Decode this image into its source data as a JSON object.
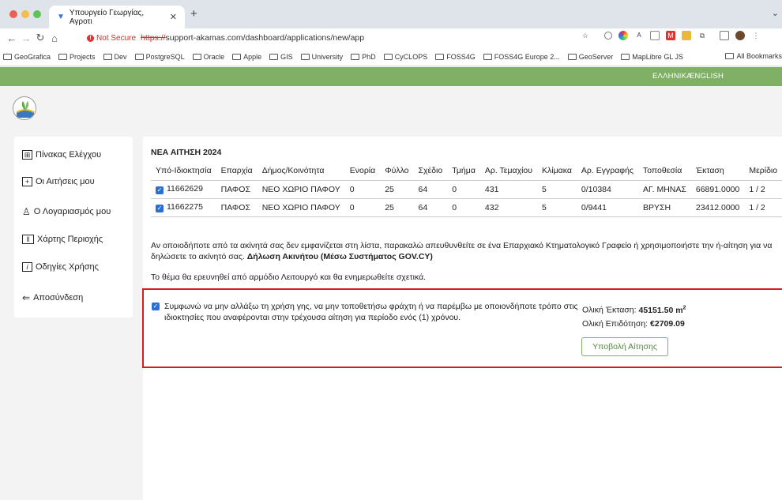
{
  "browser": {
    "tab_title": "Υπουργείο Γεωργίας, Αγροτι",
    "not_secure": "Not Secure",
    "url_scheme": "https://",
    "url_rest": "support-akamas.com/dashboard/applications/new/app",
    "bookmarks": [
      "GeoGrafica",
      "Projects",
      "Dev",
      "PostgreSQL",
      "Oracle",
      "Apple",
      "GIS",
      "University",
      "PhD",
      "CyCLOPS",
      "FOSS4G",
      "FOSS4G Europe 2...",
      "GeoServer",
      "MapLibre GL JS"
    ],
    "all_bookmarks": "All Bookmarks"
  },
  "header": {
    "lang_el": "ΕΛΛΗΝΙΚΑ",
    "lang_en": "ENGLISH",
    "accent_color": "#7fb065"
  },
  "sidebar": {
    "items": [
      {
        "label": "Πίνακας Ελέγχου",
        "icon": "dashboard-icon"
      },
      {
        "label": "Οι Αιτήσεις μου",
        "icon": "plus-square-icon"
      },
      {
        "label": "Ο Λογαριασμός μου",
        "icon": "user-icon"
      },
      {
        "label": "Χάρτης Περιοχής",
        "icon": "map-icon"
      },
      {
        "label": "Οδηγίες Χρήσης",
        "icon": "info-icon"
      },
      {
        "label": "Αποσύνδεση",
        "icon": "logout-icon"
      }
    ]
  },
  "main": {
    "section_title": "ΝΕΑ ΑΙΤΗΣΗ 2024",
    "columns": [
      "Υπό-Ιδιοκτησία",
      "Επαρχία",
      "Δήμος/Κοινότητα",
      "Ενορία",
      "Φύλλο",
      "Σχέδιο",
      "Τμήμα",
      "Αρ. Τεμαχίου",
      "Κλίμακα",
      "Αρ. Εγγραφής",
      "Τοποθεσία",
      "Έκταση",
      "Μερίδιο"
    ],
    "rows": [
      [
        "11662629",
        "ΠΑΦΟΣ",
        "ΝΕΟ ΧΩΡΙΟ ΠΑΦΟΥ",
        "0",
        "25",
        "64",
        "0",
        "431",
        "5",
        "0/10384",
        "ΑΓ. ΜΗΝΑΣ",
        "66891.0000",
        "1 / 2"
      ],
      [
        "11662275",
        "ΠΑΦΟΣ",
        "ΝΕΟ ΧΩΡΙΟ ΠΑΦΟΥ",
        "0",
        "25",
        "64",
        "0",
        "432",
        "5",
        "0/9441",
        "ΒΡΥΣΗ",
        "23412.0000",
        "1 / 2"
      ]
    ],
    "note_text": "Αν οποιοδήποτε από τα ακίνητά σας δεν εμφανίζεται στη λίστα, παρακαλώ απευθυνθείτε σε ένα Επαρχιακό Κτηματολογικό Γραφείο ή χρησιμοποιήστε την ή-αίτηση για να δηλώσετε το ακίνητό σας.",
    "note_link": "Δήλωση Ακινήτου (Μέσω Συστήματος GOV.CY)",
    "note2": "Το θέμα θα ερευνηθεί από αρμόδιο Λειτουργό και θα ενημερωθείτε σχετικά.",
    "agree_text": "Συμφωνώ να μην αλλάξω τη χρήση γης, να μην τοποθετήσω φράχτη ή να παρέμβω με οποιονδήποτε τρόπο στις ιδιοκτησίες που αναφέρονται στην τρέχουσα αίτηση για περίοδο ενός (1) χρόνου.",
    "total_area_label": "Ολική Έκταση:",
    "total_area_value": "45151.50 m",
    "total_area_sup": "2",
    "total_subsidy_label": "Ολική Επιδότηση:",
    "total_subsidy_value": "€2709.09",
    "submit_label": "Υποβολή Αίτησης",
    "highlight_color": "#d71e1e"
  }
}
